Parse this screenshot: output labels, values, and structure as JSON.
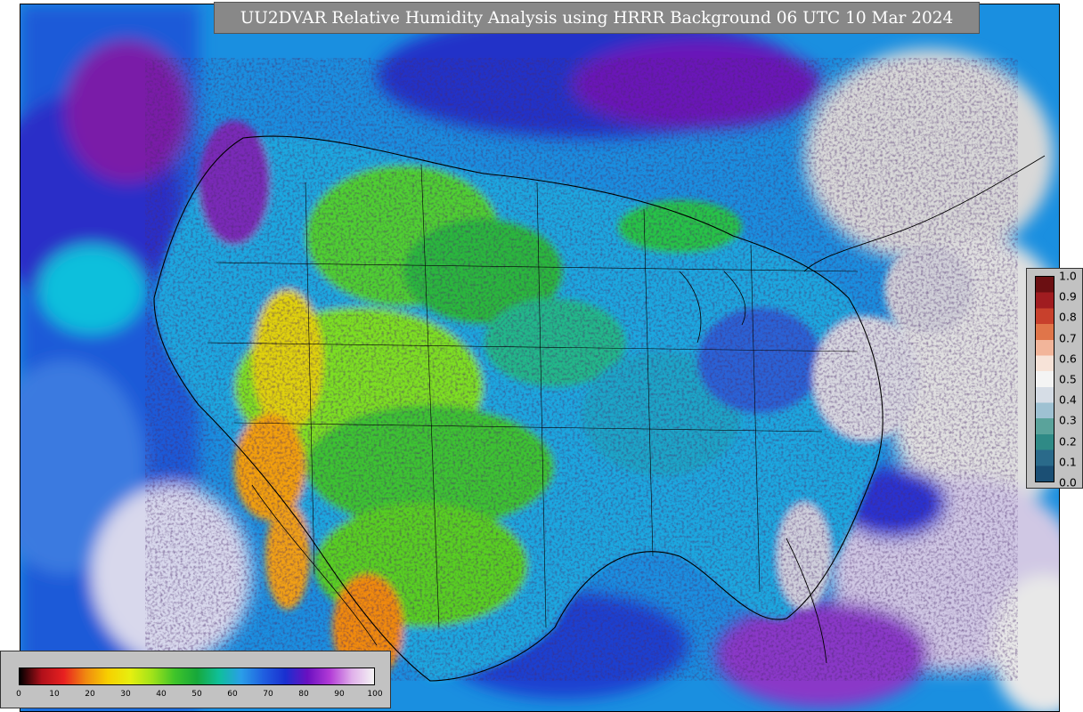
{
  "title": "UU2DVAR Relative Humidity Analysis using HRRR Background 06 UTC 10 Mar 2024",
  "rh_colorbar": {
    "ticks": [
      "0",
      "10",
      "20",
      "30",
      "40",
      "50",
      "60",
      "70",
      "80",
      "90",
      "100"
    ],
    "colors": [
      "#000000",
      "#b0101a",
      "#e82020",
      "#f08a10",
      "#f7d000",
      "#e6ef10",
      "#9fe21a",
      "#3fc42a",
      "#17a83a",
      "#0fbf9a",
      "#2a9ee8",
      "#2060e0",
      "#1a2fd0",
      "#6a10c0",
      "#b23ad6",
      "#e0b0ea",
      "#f4f4f4"
    ]
  },
  "station_colorbar": {
    "ticks": [
      "1.0",
      "0.9",
      "0.8",
      "0.7",
      "0.6",
      "0.5",
      "0.4",
      "0.3",
      "0.2",
      "0.1",
      "0.0"
    ],
    "colors": [
      "#6b0f12",
      "#a01c20",
      "#c8402c",
      "#e0754a",
      "#f2b59a",
      "#f7e3d8",
      "#f4f4f4",
      "#d6dde6",
      "#9ec1d2",
      "#5aa39b",
      "#2f8a86",
      "#2a6a8a",
      "#1b4f74"
    ]
  },
  "colors": {
    "ocean_light": "#e0e0e0",
    "map_bg": "#22b2e6"
  }
}
